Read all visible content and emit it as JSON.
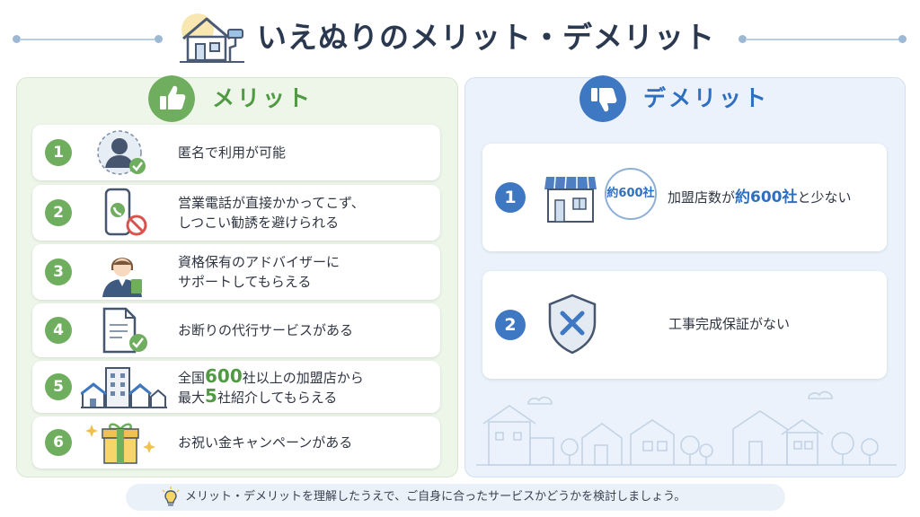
{
  "header": {
    "title": "いえぬりのメリット・デメリット",
    "icon": "house-paint-roller-icon"
  },
  "merit": {
    "label": "メリット",
    "icon": "thumbs-up-icon",
    "accent": "#6fae5f",
    "items": [
      {
        "num": "1",
        "lines": [
          "匿名で利用が可能"
        ],
        "icon": "anonymous-user-check-icon"
      },
      {
        "num": "2",
        "lines": [
          "営業電話が直接かかってこず、",
          "しつこい勧誘を避けられる"
        ],
        "icon": "phone-blocked-icon"
      },
      {
        "num": "3",
        "lines": [
          "資格保有のアドバイザーに",
          "サポートしてもらえる"
        ],
        "icon": "advisor-icon"
      },
      {
        "num": "4",
        "lines": [
          "お断りの代行サービスがある"
        ],
        "icon": "document-check-icon"
      },
      {
        "num": "5",
        "line1": {
          "pre": "全国",
          "hl": "600",
          "post": "社以上の加盟店から"
        },
        "line2": {
          "pre": "最大",
          "hl": "5",
          "post": "社紹介してもらえる"
        },
        "icon": "buildings-icon"
      },
      {
        "num": "6",
        "lines": [
          "お祝い金キャンペーンがある"
        ],
        "icon": "gift-box-icon"
      }
    ]
  },
  "demerit": {
    "label": "デメリット",
    "icon": "thumbs-down-icon",
    "accent": "#3f78c2",
    "items": [
      {
        "num": "1",
        "badge": "約600社",
        "text": {
          "pre": "加盟店数が",
          "hl": "約600社",
          "post": "と少ない"
        },
        "icon": "store-icon"
      },
      {
        "num": "2",
        "text": "工事完成保証がない",
        "icon": "shield-x-icon"
      }
    ]
  },
  "footer": {
    "text": "メリット・デメリットを理解したうえで、ご自身に合ったサービスかどうかを検討しましょう。",
    "icon": "lightbulb-icon"
  }
}
